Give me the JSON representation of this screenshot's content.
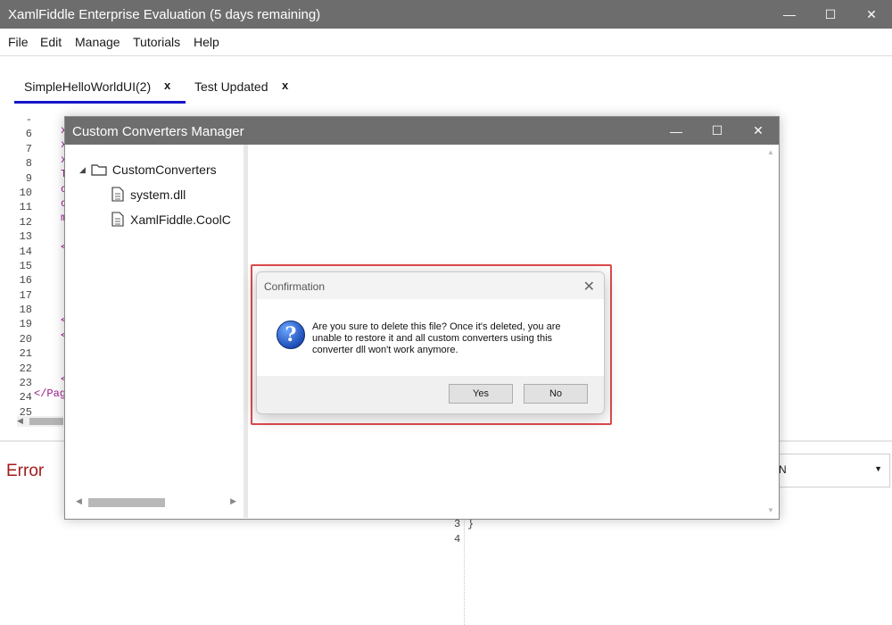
{
  "window": {
    "title": "XamlFiddle Enterprise Evaluation (5 days remaining)",
    "minimize": "—",
    "maximize": "☐",
    "close": "✕"
  },
  "menu": [
    "File",
    "Edit",
    "Manage",
    "Tutorials",
    "Help"
  ],
  "tabs": [
    {
      "label": "SimpleHelloWorldUI(2)",
      "close": "x"
    },
    {
      "label": "Test Updated",
      "close": "x"
    }
  ],
  "editor": {
    "line_numbers": [
      "-",
      "6",
      "7",
      "8",
      "9",
      "10",
      "11",
      "12",
      "13",
      "14",
      "15",
      "16",
      "17",
      "18",
      "19",
      "20",
      "21",
      "22",
      "23",
      "24",
      "25"
    ],
    "closing_tag": "</Pag",
    "fragments": [
      "x",
      "x",
      "x",
      "T",
      "c",
      "c",
      "m",
      "<",
      "<",
      "<",
      "<"
    ]
  },
  "error_label": "Error",
  "right_dropdown_value": "N",
  "bottom_lines": [
    "3",
    "4"
  ],
  "bottom_code": "}",
  "manager": {
    "title": "Custom Converters Manager",
    "tree_root": "CustomConverters",
    "tree_items": [
      "system.dll",
      "XamlFiddle.CoolC"
    ]
  },
  "confirmation": {
    "title": "Confirmation",
    "message": "Are you sure to delete this file? Once it's deleted, you are unable to restore it and all custom converters using this converter dll won't work anymore.",
    "yes": "Yes",
    "no": "No",
    "icon": "question-icon"
  }
}
